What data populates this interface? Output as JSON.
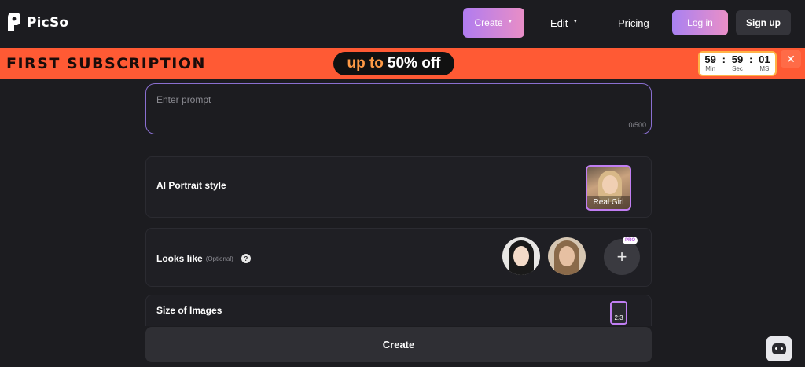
{
  "header": {
    "brand": "PicSo",
    "nav": {
      "create": "Create",
      "edit": "Edit",
      "pricing": "Pricing"
    },
    "login": "Log in",
    "signup": "Sign up"
  },
  "banner": {
    "title": "FIRST SUBSCRIPTION",
    "deal_prefix": "up to",
    "deal_value": "50% off",
    "timer": {
      "min": "59",
      "sec": "59",
      "ms": "01",
      "min_label": "Min",
      "sec_label": "Sec",
      "ms_label": "MS"
    }
  },
  "form": {
    "prompt_placeholder": "Enter prompt",
    "prompt_count": "0/500",
    "portrait_label": "AI Portrait style",
    "portrait_style": "Real Girl",
    "looks_label": "Looks like",
    "looks_optional": "(Optional)",
    "help": "?",
    "add": "+",
    "pro_badge": "PRO",
    "size_label": "Size of Images",
    "ratio": "2:3",
    "create_button": "Create"
  },
  "colors": {
    "accent_gradient_start": "#b07cf0",
    "accent_gradient_end": "#e98ec6",
    "banner": "#ff5a34",
    "background": "#1c1c20"
  }
}
